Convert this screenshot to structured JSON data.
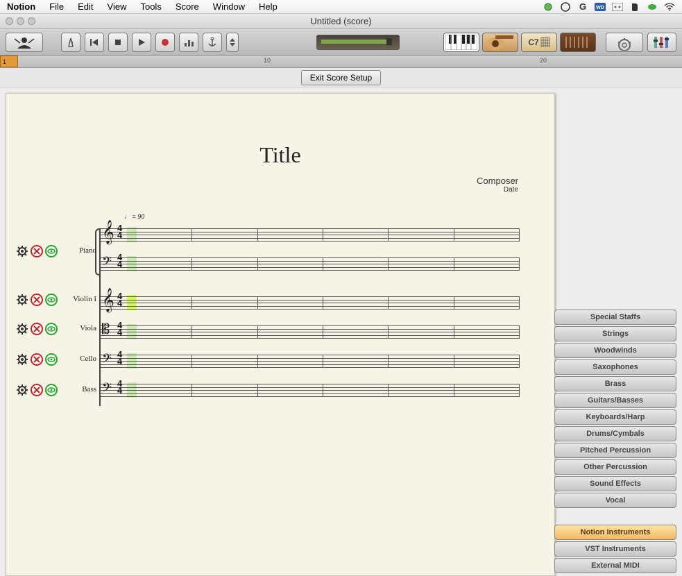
{
  "menubar": {
    "app": "Notion",
    "items": [
      "File",
      "Edit",
      "View",
      "Tools",
      "Score",
      "Window",
      "Help"
    ]
  },
  "window": {
    "title": "Untitled (score)"
  },
  "ruler": {
    "marker": "1",
    "tick10": "10",
    "tick20": "20"
  },
  "exit_button": "Exit Score Setup",
  "score": {
    "title": "Title",
    "composer": "Composer",
    "date": "Date",
    "tempo": "♩ = 90",
    "timesig_top": "4",
    "timesig_bottom": "4"
  },
  "instruments": [
    "Piano",
    "Violin I",
    "Viola",
    "Cello",
    "Bass"
  ],
  "categories": [
    "Special Staffs",
    "Strings",
    "Woodwinds",
    "Saxophones",
    "Brass",
    "Guitars/Basses",
    "Keyboards/Harp",
    "Drums/Cymbals",
    "Pitched Percussion",
    "Other Percussion",
    "Sound Effects",
    "Vocal"
  ],
  "sources": [
    "Notion Instruments",
    "VST Instruments",
    "External MIDI"
  ],
  "selected_source_index": 0
}
